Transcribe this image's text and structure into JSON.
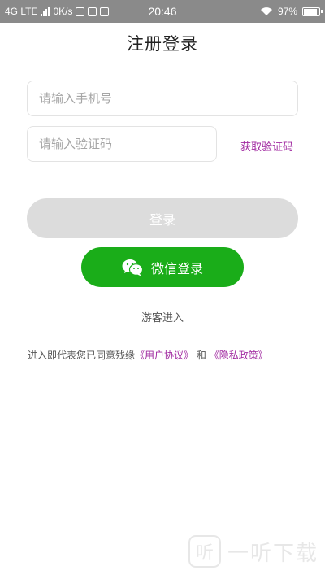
{
  "status_bar": {
    "network": "4G LTE",
    "speed": "0K/s",
    "time": "20:46",
    "battery": "97%",
    "battery_level": 0.97
  },
  "page": {
    "title": "注册登录"
  },
  "form": {
    "phone_placeholder": "请输入手机号",
    "code_placeholder": "请输入验证码",
    "get_code_label": "获取验证码",
    "login_label": "登录",
    "wechat_login_label": "微信登录",
    "guest_label": "游客进入"
  },
  "agreement": {
    "prefix": "进入即代表您已同意残缘",
    "user_agreement": "《用户协议》",
    "and": "和",
    "privacy_policy": "《隐私政策》"
  },
  "watermark": {
    "logo_char": "听",
    "text": "一听下载"
  },
  "colors": {
    "accent_link": "#a12aa1",
    "wechat_green": "#1aad19",
    "disabled_button": "#dcdcdc"
  }
}
